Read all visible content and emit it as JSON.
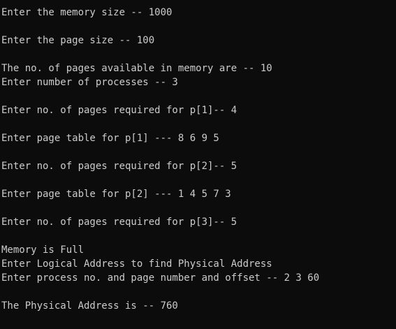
{
  "console": {
    "background": "#0c0c0c",
    "text_color": "#cccccc",
    "lines": [
      "Enter the memory size -- 1000",
      "",
      "Enter the page size -- 100",
      "",
      "The no. of pages available in memory are -- 10",
      "Enter number of processes -- 3",
      "",
      "Enter no. of pages required for p[1]-- 4",
      "",
      "Enter page table for p[1] --- 8 6 9 5",
      "",
      "Enter no. of pages required for p[2]-- 5",
      "",
      "Enter page table for p[2] --- 1 4 5 7 3",
      "",
      "Enter no. of pages required for p[3]-- 5",
      "",
      "Memory is Full",
      "Enter Logical Address to find Physical Address",
      "Enter process no. and page number and offset -- 2 3 60",
      "",
      "The Physical Address is -- 760"
    ]
  }
}
